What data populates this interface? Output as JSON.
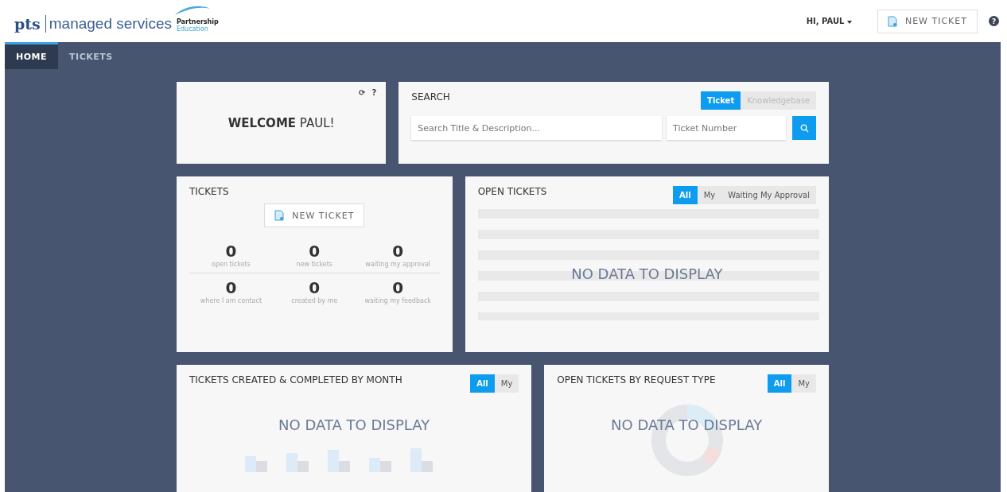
{
  "header": {
    "logo_brand": "pts",
    "logo_text": "managed services",
    "partner_line1": "Partnership",
    "partner_line2": "Education",
    "user_menu": "HI, PAUL",
    "new_ticket_button": "NEW TICKET",
    "help": "?"
  },
  "nav": {
    "tabs": [
      {
        "label": "HOME",
        "selected": true
      },
      {
        "label": "TICKETS",
        "selected": false
      }
    ]
  },
  "welcome": {
    "text": "**WELCOME** PAUL!",
    "refresh": "⟳",
    "help": "?"
  },
  "search": {
    "title": "SEARCH",
    "modes": [
      {
        "label": "Ticket",
        "selected": true
      },
      {
        "label": "Knowledgebase",
        "selected": false
      }
    ],
    "title_placeholder": "Search Title & Description...",
    "number_placeholder": "Ticket Number"
  },
  "tickets": {
    "title": "TICKETS",
    "new_ticket_button": "NEW TICKET",
    "stats": [
      {
        "value": "0",
        "label": "open tickets"
      },
      {
        "value": "0",
        "label": "new tickets"
      },
      {
        "value": "0",
        "label": "waiting my approval"
      },
      {
        "value": "0",
        "label": "where I am contact"
      },
      {
        "value": "0",
        "label": "created by me"
      },
      {
        "value": "0",
        "label": "waiting my feedback"
      }
    ]
  },
  "open_tickets": {
    "title": "OPEN TICKETS",
    "filters": [
      {
        "label": "All",
        "selected": true
      },
      {
        "label": "My",
        "selected": false
      },
      {
        "label": "Waiting My Approval",
        "selected": false
      }
    ],
    "empty": "NO DATA TO DISPLAY"
  },
  "by_month": {
    "title": "TICKETS CREATED & COMPLETED BY MONTH",
    "filters": [
      {
        "label": "All",
        "selected": true
      },
      {
        "label": "My",
        "selected": false
      }
    ],
    "empty": "NO DATA TO DISPLAY"
  },
  "by_type": {
    "title": "OPEN TICKETS BY REQUEST TYPE",
    "filters": [
      {
        "label": "All",
        "selected": true
      },
      {
        "label": "My",
        "selected": false
      }
    ],
    "empty": "NO DATA TO DISPLAY"
  }
}
